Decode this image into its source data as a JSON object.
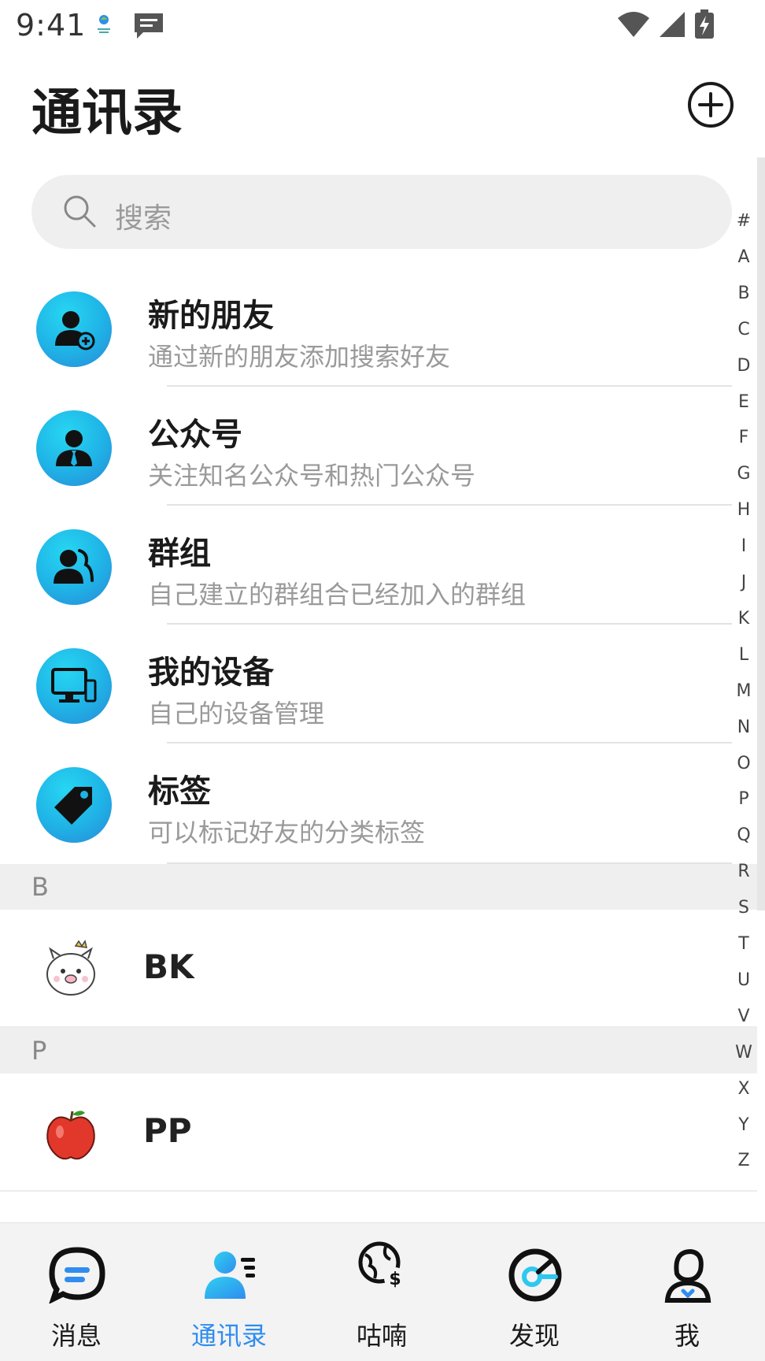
{
  "status_bar": {
    "time": "9:41",
    "icons": [
      "app-logo-icon",
      "message-notification-icon",
      "wifi-icon",
      "cellular-signal-icon",
      "battery-charging-icon"
    ]
  },
  "header": {
    "title": "通讯录",
    "add_icon": "plus-circle-icon"
  },
  "search": {
    "placeholder": "搜索",
    "icon": "search-icon"
  },
  "menu": [
    {
      "title": "新的朋友",
      "subtitle": "通过新的朋友添加搜索好友",
      "icon": "add-friend-icon"
    },
    {
      "title": "公众号",
      "subtitle": "关注知名公众号和热门公众号",
      "icon": "official-account-icon"
    },
    {
      "title": "群组",
      "subtitle": "自己建立的群组合已经加入的群组",
      "icon": "group-icon"
    },
    {
      "title": "我的设备",
      "subtitle": "自己的设备管理",
      "icon": "devices-icon"
    },
    {
      "title": "标签",
      "subtitle": "可以标记好友的分类标签",
      "icon": "tag-icon"
    }
  ],
  "sections": [
    {
      "letter": "B",
      "contacts": [
        {
          "name": "BK",
          "avatar": "pig-avatar-icon"
        }
      ]
    },
    {
      "letter": "P",
      "contacts": [
        {
          "name": "PP",
          "avatar": "apple-avatar-icon"
        }
      ]
    }
  ],
  "alphabet": [
    "#",
    "A",
    "B",
    "C",
    "D",
    "E",
    "F",
    "G",
    "H",
    "I",
    "J",
    "K",
    "L",
    "M",
    "N",
    "O",
    "P",
    "Q",
    "R",
    "S",
    "T",
    "U",
    "V",
    "W",
    "X",
    "Y",
    "Z"
  ],
  "bottom_nav": {
    "active": "通讯录",
    "items": [
      {
        "label": "消息",
        "icon": "chat-bubble-icon"
      },
      {
        "label": "通讯录",
        "icon": "contacts-icon"
      },
      {
        "label": "咕喃",
        "icon": "globe-dollar-icon"
      },
      {
        "label": "发现",
        "icon": "discover-icon"
      },
      {
        "label": "我",
        "icon": "profile-icon"
      }
    ]
  },
  "colors": {
    "accent": "#2f8df0",
    "avatar_gradient_start": "#27d6f2",
    "avatar_gradient_end": "#2a86d6",
    "section_bg": "#efefef"
  }
}
